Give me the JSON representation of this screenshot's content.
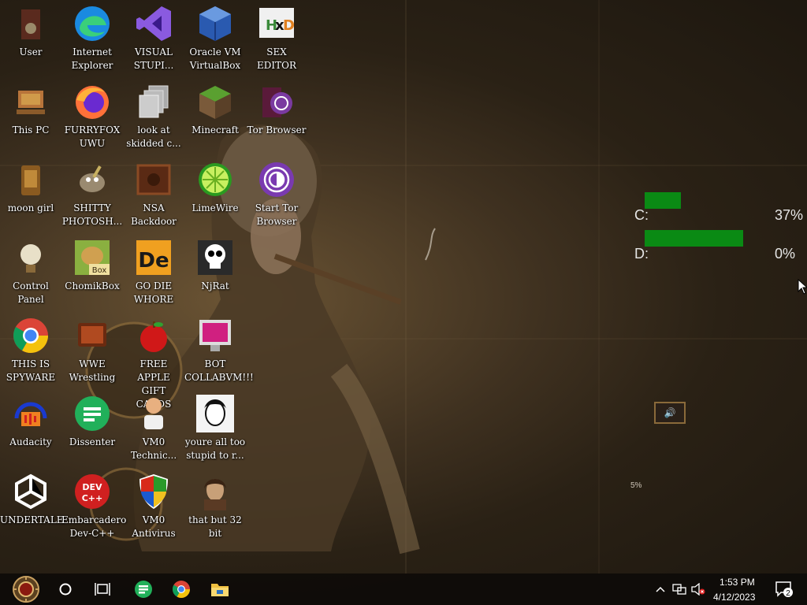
{
  "desktop": {
    "icons": [
      {
        "label": "User"
      },
      {
        "label": "Internet\nExplorer"
      },
      {
        "label": "VISUAL\nSTUPI..."
      },
      {
        "label": "Oracle VM\nVirtualBox"
      },
      {
        "label": "SEX\nEDITOR"
      },
      {
        "label": "This PC"
      },
      {
        "label": "FURRYFOX\nUWU"
      },
      {
        "label": "look at\nskidded c..."
      },
      {
        "label": "Minecraft"
      },
      {
        "label": "Tor Browser"
      },
      {
        "label": "moon girl"
      },
      {
        "label": "SHITTY\nPHOTOSH..."
      },
      {
        "label": "NSA\nBackdoor"
      },
      {
        "label": "LimeWire"
      },
      {
        "label": "Start Tor\nBrowser"
      },
      {
        "label": "Control Panel"
      },
      {
        "label": "ChomikBox"
      },
      {
        "label": "GO DIE\nWHORE"
      },
      {
        "label": "NjRat"
      },
      {
        "label": "THIS IS\nSPYWARE"
      },
      {
        "label": "WWE\nWrestling"
      },
      {
        "label": "FREE APPLE\nGIFT CARDS"
      },
      {
        "label": "BOT\nCOLLABVM!!!"
      },
      {
        "label": "Audacity"
      },
      {
        "label": "Dissenter"
      },
      {
        "label": "VM0\nTechnic..."
      },
      {
        "label": "youre all too\nstupid to r..."
      },
      {
        "label": "UNDERTALE"
      },
      {
        "label": "Embarcadero\nDev-C++"
      },
      {
        "label": "VM0\nAntivirus"
      },
      {
        "label": "that but 32\nbit"
      }
    ]
  },
  "drive_widget": {
    "drives": [
      {
        "label": "C:",
        "percent_text": "37%",
        "usage": 0.37
      },
      {
        "label": "D:",
        "percent_text": "0%",
        "usage": 0.0
      }
    ],
    "misc_percent": "5%"
  },
  "taskbar": {
    "time": "1:53 PM",
    "date": "4/12/2023",
    "notification_count": "2",
    "pinned": [
      "start-orb-icon",
      "cortana-circle-icon",
      "task-view-icon",
      "dissenter-icon",
      "chrome-icon",
      "file-explorer-icon"
    ]
  },
  "colors": {
    "bar": "#0a8a14",
    "taskbar": "#0c0a08"
  }
}
